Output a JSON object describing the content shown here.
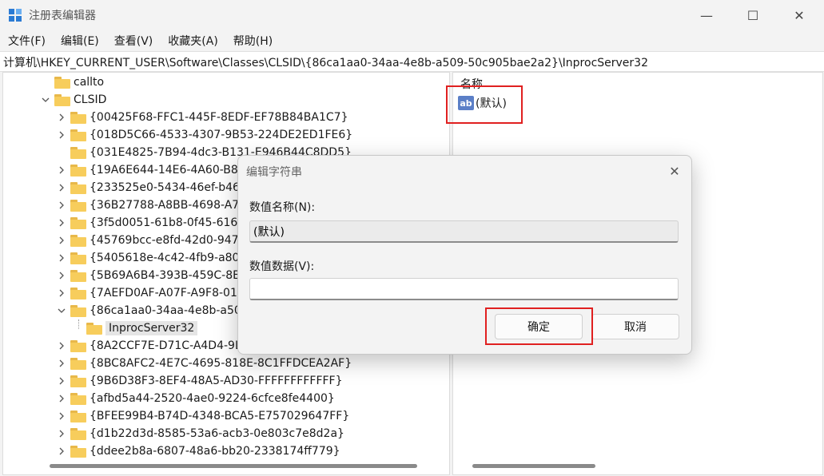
{
  "window": {
    "title": "注册表编辑器",
    "minimize_glyph": "—",
    "maximize_glyph": "☐",
    "close_glyph": "✕"
  },
  "menu": [
    "文件(F)",
    "编辑(E)",
    "查看(V)",
    "收藏夹(A)",
    "帮助(H)"
  ],
  "address": "计算机\\HKEY_CURRENT_USER\\Software\\Classes\\CLSID\\{86ca1aa0-34aa-4e8b-a509-50c905bae2a2}\\InprocServer32",
  "tree": {
    "items": [
      {
        "label": "callto",
        "level": 0,
        "chevron": ""
      },
      {
        "label": "CLSID",
        "level": 0,
        "chevron": "expanded"
      },
      {
        "label": "{00425F68-FFC1-445F-8EDF-EF78B84BA1C7}",
        "level": 1,
        "chevron": "collapsed"
      },
      {
        "label": "{018D5C66-4533-4307-9B53-224DE2ED1FE6}",
        "level": 1,
        "chevron": "collapsed"
      },
      {
        "label": "{031E4825-7B94-4dc3-B131-E946B44C8DD5}",
        "level": 1,
        "chevron": ""
      },
      {
        "label": "{19A6E644-14E6-4A60-B8D",
        "level": 1,
        "chevron": "collapsed"
      },
      {
        "label": "{233525e0-5434-46ef-b46",
        "level": 1,
        "chevron": "collapsed"
      },
      {
        "label": "{36B27788-A8BB-4698-A7",
        "level": 1,
        "chevron": "collapsed"
      },
      {
        "label": "{3f5d0051-61b8-0f45-616",
        "level": 1,
        "chevron": "collapsed"
      },
      {
        "label": "{45769bcc-e8fd-42d0-947",
        "level": 1,
        "chevron": "collapsed"
      },
      {
        "label": "{5405618e-4c42-4fb9-a80",
        "level": 1,
        "chevron": "collapsed"
      },
      {
        "label": "{5B69A6B4-393B-459C-8E",
        "level": 1,
        "chevron": "collapsed"
      },
      {
        "label": "{7AEFD0AF-A07F-A9F8-01",
        "level": 1,
        "chevron": "collapsed"
      },
      {
        "label": "{86ca1aa0-34aa-4e8b-a50",
        "level": 1,
        "chevron": "expanded"
      },
      {
        "label": "InprocServer32",
        "level": 2,
        "chevron": "",
        "selected": true
      },
      {
        "label": "{8A2CCF7E-D71C-A4D4-9L",
        "level": 1,
        "chevron": "collapsed"
      },
      {
        "label": "{8BC8AFC2-4E7C-4695-818E-8C1FFDCEA2AF}",
        "level": 1,
        "chevron": "collapsed"
      },
      {
        "label": "{9B6D38F3-8EF4-48A5-AD30-FFFFFFFFFFFF}",
        "level": 1,
        "chevron": "collapsed"
      },
      {
        "label": "{afbd5a44-2520-4ae0-9224-6cfce8fe4400}",
        "level": 1,
        "chevron": "collapsed"
      },
      {
        "label": "{BFEE99B4-B74D-4348-BCA5-E757029647FF}",
        "level": 1,
        "chevron": "collapsed"
      },
      {
        "label": "{d1b22d3d-8585-53a6-acb3-0e803c7e8d2a}",
        "level": 1,
        "chevron": "collapsed"
      },
      {
        "label": "{ddee2b8a-6807-48a6-bb20-2338174ff779}",
        "level": 1,
        "chevron": "collapsed"
      }
    ]
  },
  "values_pane": {
    "header": "名称",
    "rows": [
      {
        "icon_text": "ab",
        "name": "(默认)"
      }
    ]
  },
  "dialog": {
    "title": "编辑字符串",
    "close_glyph": "✕",
    "name_label": "数值名称(N):",
    "name_value": "(默认)",
    "data_label": "数值数据(V):",
    "data_value": "",
    "ok_label": "确定",
    "cancel_label": "取消"
  },
  "colors": {
    "highlight": "#e02020",
    "folder": "#f7cd5c",
    "icon_blue": "#5b7fc7"
  }
}
